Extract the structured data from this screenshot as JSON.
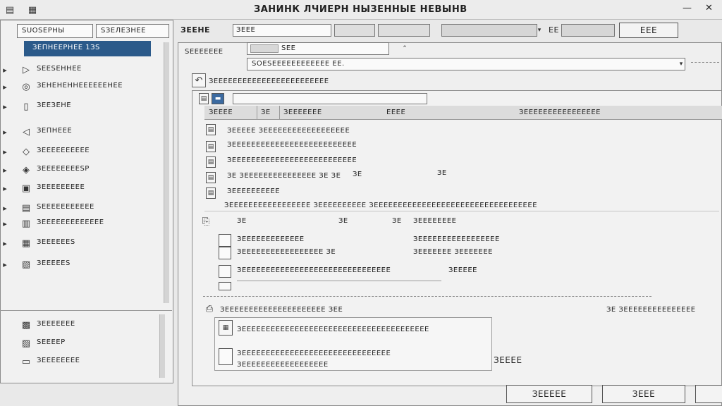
{
  "window": {
    "title": "ЗАНИНК ЛЧИЕРН НЫЗЕННЫЕ НЕВЫНВ",
    "min_label": "—",
    "close_label": "✕"
  },
  "left_panel": {
    "dropdown_a": "SUОSЕРНЫ",
    "dropdown_b": "SЗЕЛЕЗНЕЕ",
    "selected_item": "ЗЕПНЕЕРНЕЕ 1ЗS",
    "items": [
      {
        "icon": "▷",
        "label": "SЕЕSЕННЕЕ"
      },
      {
        "icon": "◎",
        "label": "ЗЕНЕНЕННЕЕЕЕЕЕНЕЕ"
      },
      {
        "icon": "▯",
        "label": "ЗЕЕЗЕНЕ"
      },
      {
        "icon": "◁",
        "label": "ЗЕПНЕЕЕ"
      },
      {
        "icon": "◇",
        "label": "ЗЕЕЕЕЕЕЕЕЕЕ"
      },
      {
        "icon": "◈",
        "label": "ЗЕЕЕЕЕЕЕЕSР"
      },
      {
        "icon": "▣",
        "label": "ЗЕЕЕЕЕЕЕЕЕ"
      },
      {
        "icon": "▤",
        "label": "SЕЕЕЕЕЕЕЕЕЕЕ"
      },
      {
        "icon": "▥",
        "label": "ЗЕЕЕЕЕЕЕЕЕЕЕЕЕ"
      },
      {
        "icon": "▦",
        "label": "ЗЕЕЕЕЕЕS"
      },
      {
        "icon": "▧",
        "label": "ЗЕЕЕЕЕS"
      }
    ],
    "bottom_items": [
      {
        "icon": "▩",
        "label": "ЗЕЕЕЕЕЕЕ"
      },
      {
        "icon": "▨",
        "label": "SЕЕЕЕР"
      },
      {
        "icon": "▭",
        "label": "ЗЕЕЕЕЕЕЕЕ"
      }
    ]
  },
  "toolbar": {
    "label_a": "ЗЕЕНЕ",
    "field_a": "ЗЕЕЕ",
    "field_b": "",
    "field_c": "",
    "field_d": "",
    "field_e": "",
    "label_b": "ЕЕ",
    "button_right": "ЕЕЕ"
  },
  "main": {
    "tab_label": "SЕЕЕЕЕЕЕ",
    "tab_field": "SЕЕ",
    "address": "SОЕSЕЕЕЕЕЕЕЕЕЕЕЕ ЕЕ.",
    "path_line": "ЗЕЕЕЕЕЕЕЕЕЕЕЕЕЕЕЕЕЕЕЕЕЕЕЕ",
    "header_cols": [
      "ЗЕЕЕЕ",
      "ЗЕ",
      "ЗЕЕЕЕЕЕЕ",
      "ЕЕЕЕ",
      "ЗЕЕЕЕЕЕЕЕЕЕЕЕЕЕЕЕ"
    ],
    "detail_lines": [
      "ЗЕЕЕЕЕ ЗЕЕЕЕЕЕЕЕЕЕЕЕЕЕЕЕЕЕ",
      "ЗЕЕЕЕЕЕЕЕЕЕЕЕЕЕЕЕЕЕЕЕЕЕЕЕЕЕ",
      "ЗЕЕЕЕЕЕЕЕЕЕЕЕЕЕЕЕЕЕЕЕЕЕЕЕЕЕ",
      "ЗЕ ЗЕЕЕЕЕЕЕЕЕЕЕЕЕЕЕ ЗЕ ЗЕ",
      "ЗЕЕЕЕЕЕЕЕЕЕ"
    ],
    "detail_side_a": "ЗЕ",
    "detail_side_b": "ЗЕ",
    "wide_line": "ЗЕЕЕЕЕЕЕЕЕЕЕЕЕЕЕЕЕ ЗЕЕЕЕЕЕЕЕЕЕ ЗЕЕЕЕЕЕЕЕЕЕЕЕЕЕЕЕЕЕЕЕЕЕЕЕЕЕЕЕЕЕЕЕЕЕ",
    "row_marks": [
      "ЗЕ",
      "ЗЕ",
      "ЗЕ",
      "ЗЕЕЕЕЕЕЕЕ"
    ],
    "checklist": [
      {
        "label": "ЗЕЕЕЕЕЕЕЕЕЕЕЕЕ",
        "value": "ЗЕЕЕЕЕЕЕЕЕЕЕЕЕЕЕЕЕ"
      },
      {
        "label": "ЗЕЕЕЕЕЕЕЕЕЕЕЕЕЕЕЕЕ ЗЕ",
        "value": "ЗЕЕЕЕЕЕЕ ЗЕЕЕЕЕЕЕ"
      },
      {
        "label": "ЗЕЕЕЕЕЕЕЕЕЕЕЕЕЕЕЕЕЕЕЕЕЕЕЕЕЕЕЕЕЕЕ",
        "value": "ЗЕЕЕЕЕ"
      }
    ],
    "section2_title": "ЗЕЕЕЕЕЕЕЕЕЕЕЕЕЕЕЕЕЕЕЕЕ ЗЕЕ",
    "section2_right": "ЗЕ ЗЕЕЕЕЕЕЕЕЕЕЕЕЕЕЕ",
    "section2_lines": [
      "ЗЕЕЕЕЕЕЕЕЕЕЕЕЕЕЕЕЕЕЕЕЕЕЕЕЕЕЕЕЕЕЕЕЕЕЕЕЕЕЕ",
      "ЗЕЕЕЕЕЕЕЕЕЕЕЕЕЕЕЕЕЕЕЕЕЕЕЕЕЕЕЕЕЕЕ",
      "ЗЕЕЕЕЕЕЕЕЕЕЕЕЕЕЕЕЕЕ"
    ],
    "section2_value": "ЗЕЕЕЕ"
  },
  "footer": {
    "ok_label": "ЗЕЕЕЕЕ",
    "cancel_label": "ЗЕЕЕ"
  }
}
